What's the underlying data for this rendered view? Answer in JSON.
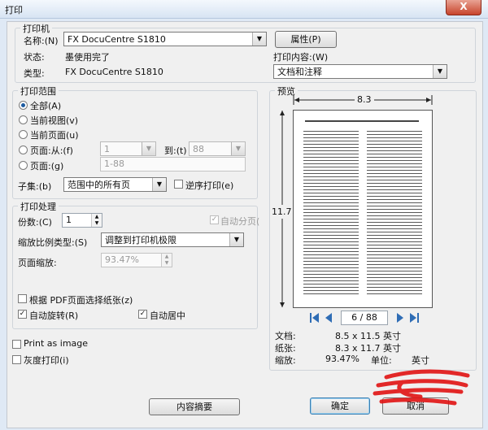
{
  "window": {
    "title": "打印",
    "close_label": "X"
  },
  "printer": {
    "group_title": "打印机",
    "name_label": "名称:(N)",
    "name_value": "FX DocuCentre S1810",
    "properties_button": "属性(P)",
    "status_label": "状态:",
    "status_value": "墨使用完了",
    "type_label": "类型:",
    "type_value": "FX DocuCentre S1810",
    "content_label": "打印内容:(W)",
    "content_value": "文档和注释"
  },
  "range": {
    "group_title": "打印范围",
    "all": "全部(A)",
    "current_view": "当前视图(v)",
    "current_page": "当前页面(u)",
    "pages_from": "页面:从:(f)",
    "from_value": "1",
    "to_label": "到:(t)",
    "to_value": "88",
    "pages": "页面:(g)",
    "pages_value": "1-88",
    "subset_label": "子集:(b)",
    "subset_value": "范围中的所有页",
    "reverse": "逆序打印(e)"
  },
  "handling": {
    "group_title": "打印处理",
    "copies_label": "份数:(C)",
    "copies_value": "1",
    "collate": "自动分页(",
    "scaling_label": "缩放比例类型:(S)",
    "scaling_value": "调整到打印机极限",
    "page_scale_label": "页面缩放:",
    "page_scale_value": "93.47%",
    "paper_source": "根据 PDF页面选择纸张(z)",
    "auto_rotate": "自动旋转(R)",
    "auto_center": "自动居中"
  },
  "options": {
    "print_as_image": "Print as image",
    "grayscale": "灰度打印(i)"
  },
  "preview": {
    "group_title": "预览",
    "width_dim": "8.3",
    "height_dim": "11.7",
    "page_indicator": "6 / 88",
    "doc_label": "文档:",
    "doc_value": "8.5 x 11.5 英寸",
    "paper_label": "纸张:",
    "paper_value": "8.3 x 11.7 英寸",
    "scale_label": "缩放:",
    "scale_value": "93.47%",
    "unit_label": "单位:",
    "unit_value": "英寸"
  },
  "buttons": {
    "summary": "内容摘要",
    "ok": "确定",
    "cancel": "取消"
  }
}
